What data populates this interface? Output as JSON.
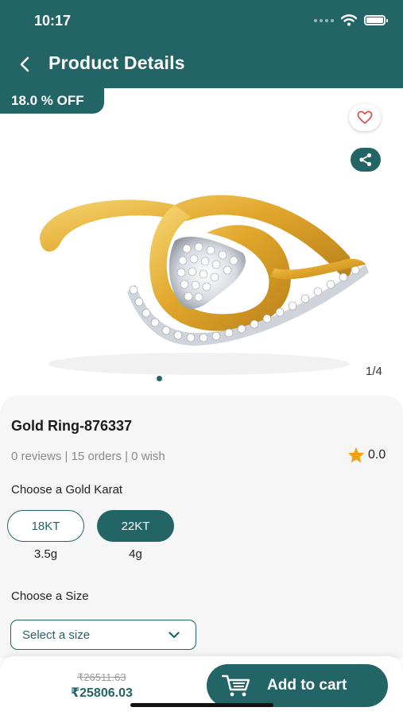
{
  "status_bar": {
    "time": "10:17"
  },
  "header": {
    "title": "Product Details"
  },
  "discount_badge": "18.0 % OFF",
  "gallery": {
    "counter": "1/4"
  },
  "product": {
    "name": "Gold Ring-876337",
    "stats": "0 reviews | 15 orders | 0 wish",
    "rating": "0.0"
  },
  "karat": {
    "heading": "Choose a Gold Karat",
    "options": [
      {
        "label": "18KT",
        "weight": "3.5g",
        "selected": false
      },
      {
        "label": "22KT",
        "weight": "4g",
        "selected": true
      }
    ]
  },
  "size": {
    "heading": "Choose a Size",
    "placeholder": "Select a size"
  },
  "pricing": {
    "old_price": "₹26511.63",
    "new_price": "₹25806.03"
  },
  "cart": {
    "label": "Add to cart"
  },
  "colors": {
    "primary": "#236467",
    "star": "#f2a20c",
    "heart": "#d9534f",
    "background": "#f6f6f6"
  },
  "icons": [
    "back-arrow-icon",
    "wifi-icon",
    "battery-icon",
    "heart-icon",
    "share-icon",
    "star-icon",
    "chevron-down-icon",
    "cart-icon"
  ]
}
